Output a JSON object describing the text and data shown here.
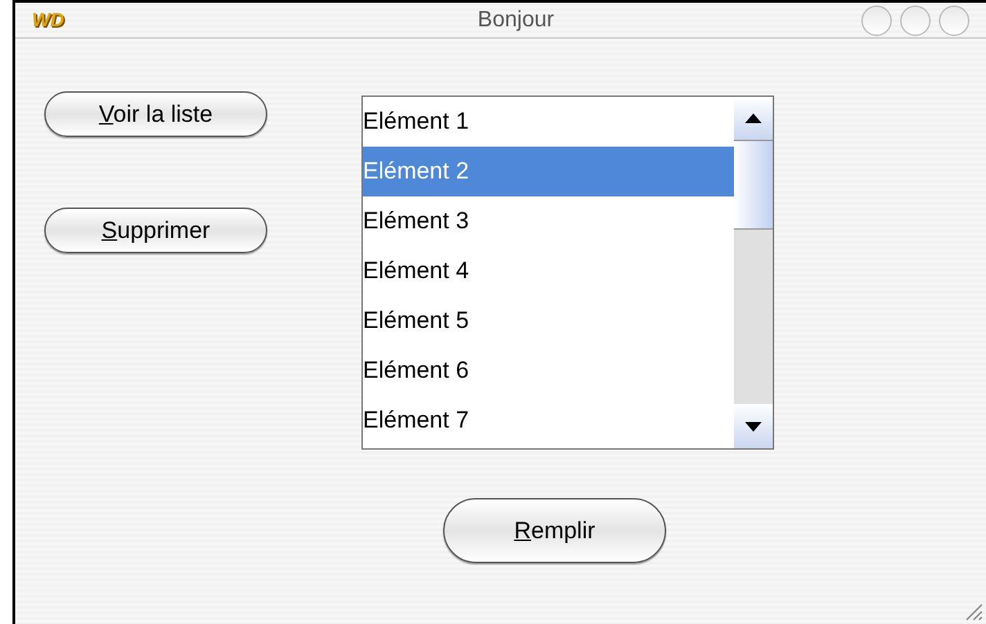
{
  "window": {
    "logo": "WD",
    "title": "Bonjour"
  },
  "buttons": [
    {
      "mnemonic": "V",
      "label_rest": "oir la liste"
    },
    {
      "mnemonic": "S",
      "label_rest": "upprimer"
    }
  ],
  "list": {
    "items": [
      {
        "label": "Elément 1",
        "selected": false
      },
      {
        "label": "Elément 2",
        "selected": true
      },
      {
        "label": "Elément 3",
        "selected": false
      },
      {
        "label": "Elément 4",
        "selected": false
      },
      {
        "label": "Elément 5",
        "selected": false
      },
      {
        "label": "Elément 6",
        "selected": false
      },
      {
        "label": "Elément 7",
        "selected": false
      }
    ]
  },
  "fill_button": {
    "mnemonic": "R",
    "label_rest": "emplir"
  }
}
